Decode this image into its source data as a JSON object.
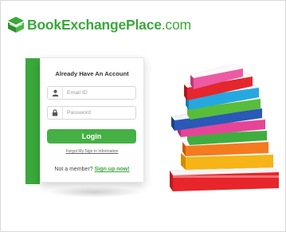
{
  "brand": {
    "name_bold": "BookExchangePlace",
    "name_suffix": ".com",
    "color": "#3aa83a"
  },
  "login": {
    "title": "Already Have An Account",
    "email_placeholder": "Email ID",
    "password_placeholder": "Password",
    "login_label": "Login",
    "forgot_label": "Forgot My Sign In Information",
    "member_text": "Not a member?",
    "signup_label": "Sign up now!"
  },
  "icons": [
    "logo-cube-icon",
    "user-icon",
    "lock-icon"
  ],
  "colors": {
    "accent": "#3aa83a",
    "button": "#45b045"
  }
}
